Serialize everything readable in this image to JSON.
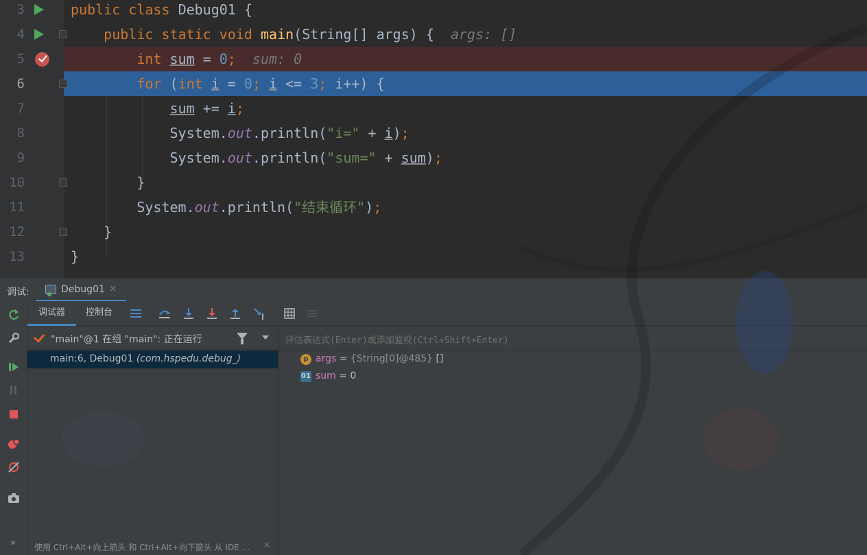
{
  "editor": {
    "lines": [
      {
        "num": "3"
      },
      {
        "num": "4"
      },
      {
        "num": "5"
      },
      {
        "num": "6"
      },
      {
        "num": "7"
      },
      {
        "num": "8"
      },
      {
        "num": "9"
      },
      {
        "num": "10"
      },
      {
        "num": "11"
      },
      {
        "num": "12"
      },
      {
        "num": "13"
      }
    ],
    "tokens": {
      "l3_public": "public",
      "l3_class": "class",
      "l3_name": "Debug01",
      "l3_brace": " {",
      "l4_public": "public",
      "l4_static": "static",
      "l4_void": "void",
      "l4_main": "main",
      "l4_sig": "(String[] args) {",
      "l4_hint": "args: []",
      "l5_int": "int",
      "l5_sum": "sum",
      "l5_eq": " = ",
      "l5_zero": "0",
      "l5_semi": ";",
      "l5_hint": "sum: 0",
      "l6_for": "for",
      "l6_open": " (",
      "l6_int": "int",
      "l6_i": "i",
      "l6_eq": " = ",
      "l6_zero": "0",
      "l6_semi1": "; ",
      "l6_i2": "i",
      "l6_le": " <= ",
      "l6_three": "3",
      "l6_semi2": "; ",
      "l6_inc": "i++) {",
      "l7_sum": "sum",
      "l7_op": " += ",
      "l7_i": "i",
      "l7_semi": ";",
      "l8_sys": "System.",
      "l8_out": "out",
      "l8_call": ".println(",
      "l8_str": "\"i=\"",
      "l8_plus": " + ",
      "l8_i": "i",
      "l8_close": ")",
      "l8_semi": ";",
      "l9_sys": "System.",
      "l9_out": "out",
      "l9_call": ".println(",
      "l9_str": "\"sum=\"",
      "l9_plus": " + ",
      "l9_sum": "sum",
      "l9_close": ")",
      "l9_semi": ";",
      "l10": "}",
      "l11_sys": "System.",
      "l11_out": "out",
      "l11_call": ".println(",
      "l11_str": "\"结束循环\"",
      "l11_close": ")",
      "l11_semi": ";",
      "l12": "}",
      "l13": "}"
    }
  },
  "debug": {
    "title": "调试:",
    "tab_label": "Debug01",
    "tab_close": "×",
    "subtabs": {
      "debugger": "调试器",
      "console": "控制台"
    },
    "thread": "\"main\"@1 在组 \"main\": 正在运行",
    "frame_main": "main:6, Debug01 ",
    "frame_pkg": "(com.hspedu.debug_)",
    "hint": "使用 Ctrl+Alt+向上箭头 和 Ctrl+Alt+向下箭头 从 IDE ...",
    "hint_close": "×",
    "expand": "»",
    "eval_placeholder": "评估表达式(Enter)或添加监视(Ctrl+Shift+Enter)",
    "variables": [
      {
        "icon": "p",
        "name": "args",
        "eq": " = ",
        "type": "{String[0]@485} ",
        "value": "[]"
      },
      {
        "icon": "01",
        "name": "sum",
        "eq": " = ",
        "type": "",
        "value": "0"
      }
    ]
  },
  "colors": {
    "editor_bg": "#2b2b2b",
    "breakpoint_line": "#4a2b2b",
    "current_line": "#2d6099",
    "keyword": "#cc7832",
    "string": "#6a8759",
    "number": "#6897bb",
    "accent": "#4a88c7"
  }
}
